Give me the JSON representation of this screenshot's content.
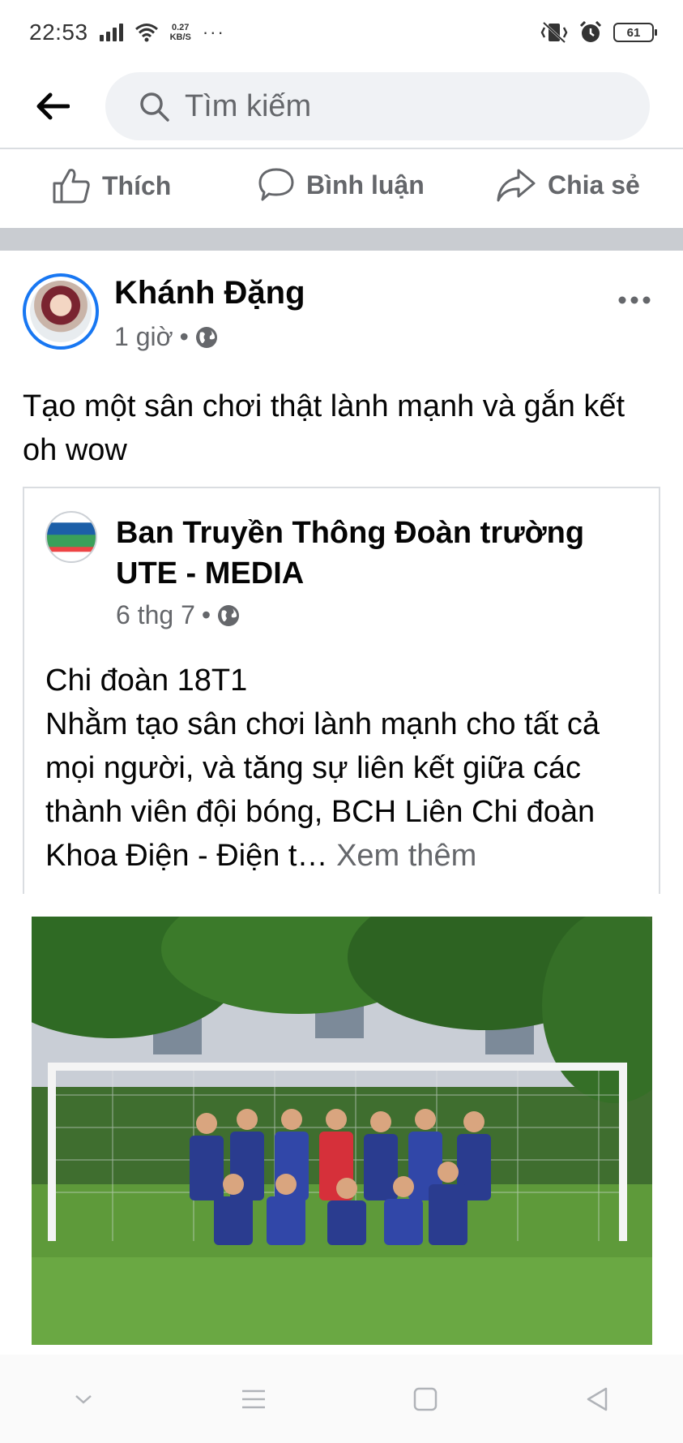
{
  "status_bar": {
    "time": "22:53",
    "net_speed_value": "0.27",
    "net_speed_unit": "KB/S",
    "more": "···",
    "battery": "61"
  },
  "search": {
    "placeholder": "Tìm kiếm"
  },
  "actions": {
    "like": "Thích",
    "comment": "Bình luận",
    "share": "Chia sẻ"
  },
  "post": {
    "author": "Khánh Đặng",
    "time": "1 giờ",
    "separator": "•",
    "text": "Tạo một sân chơi thật lành mạnh và gắn kết oh wow",
    "shared": {
      "page_name": "Ban Truyền Thông Đoàn trường UTE - MEDIA",
      "time": "6 thg 7",
      "separator": "•",
      "line1": "Chi đoàn 18T1",
      "body": "Nhằm tạo sân chơi lành mạnh cho tất cả mọi người, và tăng sự liên kết giữa các thành viên đội bóng, BCH Liên Chi đoàn Khoa Điện - Điện t…",
      "see_more": "Xem thêm"
    }
  },
  "colors": {
    "accent": "#1877f2",
    "secondary_text": "#65676b",
    "divider": "#c9ccd1"
  },
  "icons": [
    "back-arrow-icon",
    "search-icon",
    "like-icon",
    "comment-icon",
    "share-icon",
    "globe-icon",
    "more-icon",
    "nav-down-icon",
    "nav-menu-icon",
    "nav-home-icon",
    "nav-back-icon"
  ]
}
